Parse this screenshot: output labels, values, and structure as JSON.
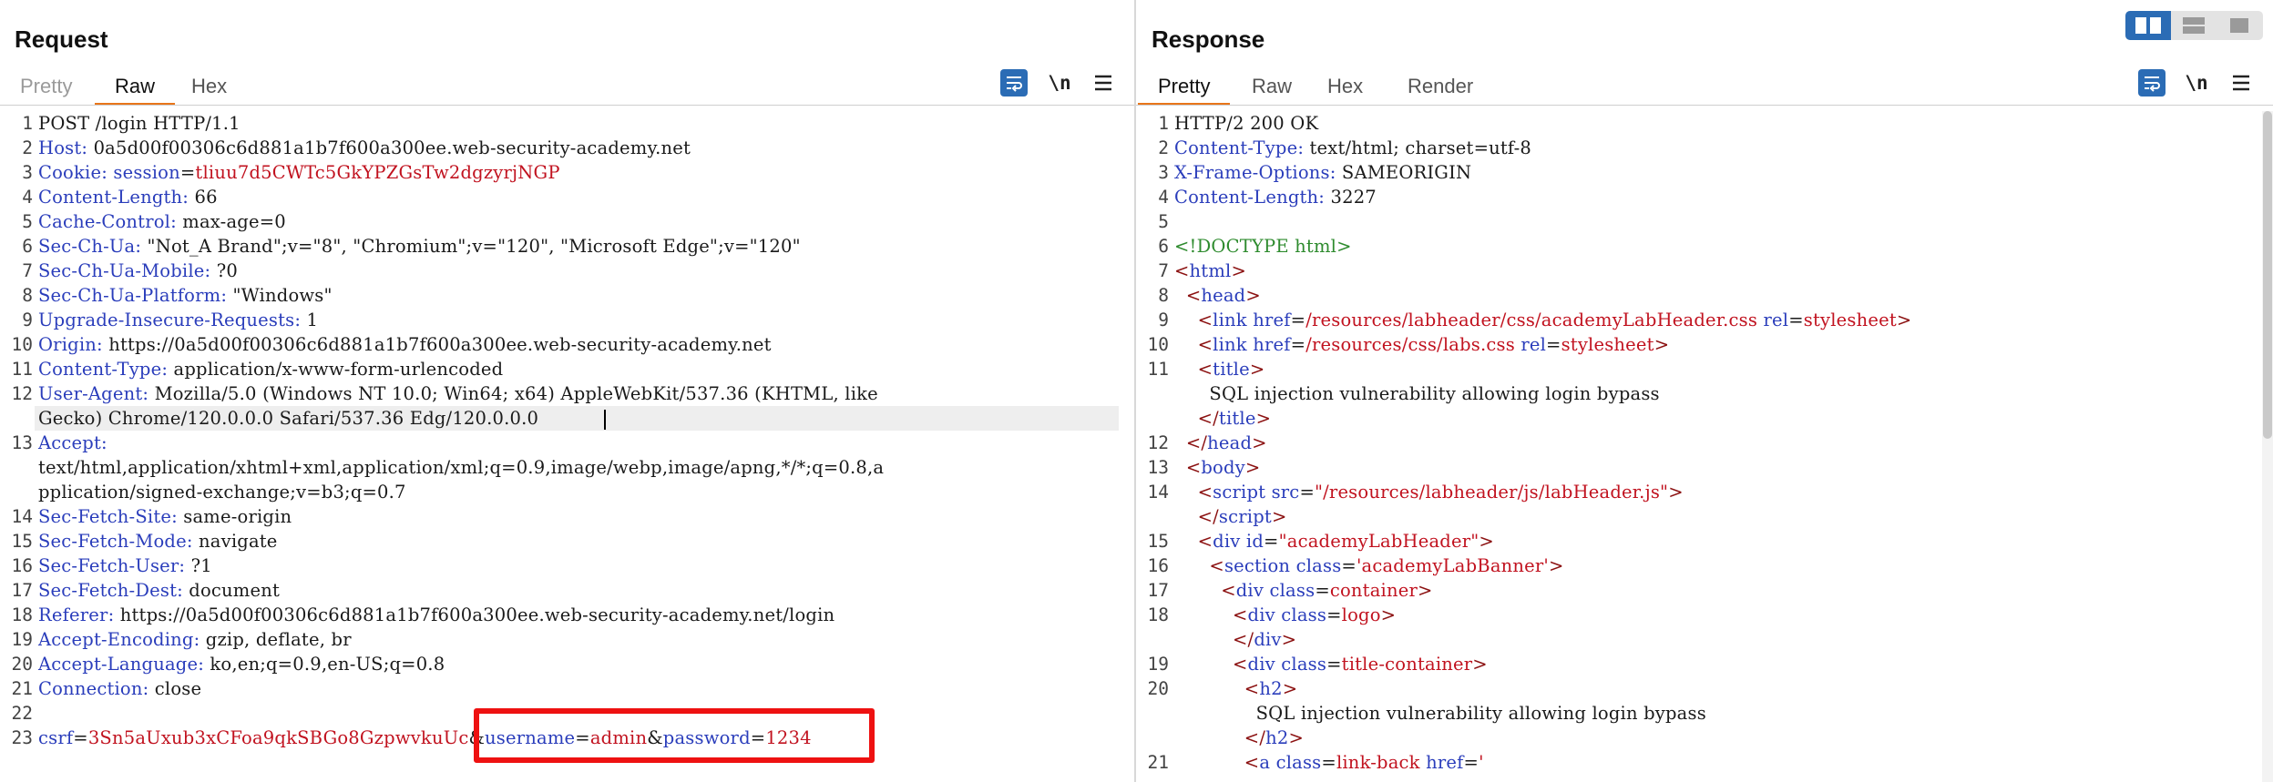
{
  "request": {
    "title": "Request",
    "tabs": [
      "Pretty",
      "Raw",
      "Hex"
    ],
    "active_tab": "Raw",
    "tools": {
      "wrap_icon": "wrap-lines-icon",
      "newline_label": "\\n",
      "menu_icon": "hamburger-menu-icon"
    },
    "lines": [
      {
        "n": "1",
        "parts": [
          [
            "t",
            "POST /login HTTP/1.1"
          ]
        ]
      },
      {
        "n": "2",
        "parts": [
          [
            "k",
            "Host:"
          ],
          [
            "t",
            " 0a5d00f00306c6d881a1b7f600a300ee.web-security-academy.net"
          ]
        ]
      },
      {
        "n": "3",
        "parts": [
          [
            "k",
            "Cookie:"
          ],
          [
            "t",
            " "
          ],
          [
            "k",
            "session"
          ],
          [
            "t",
            "="
          ],
          [
            "v",
            "tliuu7d5CWTc5GkYPZGsTw2dgzyrjNGP"
          ]
        ]
      },
      {
        "n": "4",
        "parts": [
          [
            "k",
            "Content-Length:"
          ],
          [
            "t",
            " 66"
          ]
        ]
      },
      {
        "n": "5",
        "parts": [
          [
            "k",
            "Cache-Control:"
          ],
          [
            "t",
            " max-age=0"
          ]
        ]
      },
      {
        "n": "6",
        "parts": [
          [
            "k",
            "Sec-Ch-Ua:"
          ],
          [
            "t",
            " \"Not_A Brand\";v=\"8\", \"Chromium\";v=\"120\", \"Microsoft Edge\";v=\"120\""
          ]
        ]
      },
      {
        "n": "7",
        "parts": [
          [
            "k",
            "Sec-Ch-Ua-Mobile:"
          ],
          [
            "t",
            " ?0"
          ]
        ]
      },
      {
        "n": "8",
        "parts": [
          [
            "k",
            "Sec-Ch-Ua-Platform:"
          ],
          [
            "t",
            " \"Windows\""
          ]
        ]
      },
      {
        "n": "9",
        "parts": [
          [
            "k",
            "Upgrade-Insecure-Requests:"
          ],
          [
            "t",
            " 1"
          ]
        ]
      },
      {
        "n": "10",
        "parts": [
          [
            "k",
            "Origin:"
          ],
          [
            "t",
            " https://0a5d00f00306c6d881a1b7f600a300ee.web-security-academy.net"
          ]
        ]
      },
      {
        "n": "11",
        "parts": [
          [
            "k",
            "Content-Type:"
          ],
          [
            "t",
            " application/x-www-form-urlencoded"
          ]
        ]
      },
      {
        "n": "12",
        "parts": [
          [
            "k",
            "User-Agent:"
          ],
          [
            "t",
            " Mozilla/5.0 (Windows NT 10.0; Win64; x64) AppleWebKit/537.36 (KHTML, like"
          ]
        ]
      },
      {
        "n": "",
        "parts": [
          [
            "t",
            "Gecko) Chrome/120.0.0.0 Safari/537.36 Edg/120.0.0.0"
          ]
        ]
      },
      {
        "n": "13",
        "parts": [
          [
            "k",
            "Accept:"
          ]
        ]
      },
      {
        "n": "",
        "parts": [
          [
            "t",
            "text/html,application/xhtml+xml,application/xml;q=0.9,image/webp,image/apng,*/*;q=0.8,a"
          ]
        ]
      },
      {
        "n": "",
        "parts": [
          [
            "t",
            "pplication/signed-exchange;v=b3;q=0.7"
          ]
        ]
      },
      {
        "n": "14",
        "parts": [
          [
            "k",
            "Sec-Fetch-Site:"
          ],
          [
            "t",
            " same-origin"
          ]
        ]
      },
      {
        "n": "15",
        "parts": [
          [
            "k",
            "Sec-Fetch-Mode:"
          ],
          [
            "t",
            " navigate"
          ]
        ]
      },
      {
        "n": "16",
        "parts": [
          [
            "k",
            "Sec-Fetch-User:"
          ],
          [
            "t",
            " ?1"
          ]
        ]
      },
      {
        "n": "17",
        "parts": [
          [
            "k",
            "Sec-Fetch-Dest:"
          ],
          [
            "t",
            " document"
          ]
        ]
      },
      {
        "n": "18",
        "parts": [
          [
            "k",
            "Referer:"
          ],
          [
            "t",
            " https://0a5d00f00306c6d881a1b7f600a300ee.web-security-academy.net/login"
          ]
        ]
      },
      {
        "n": "19",
        "parts": [
          [
            "k",
            "Accept-Encoding:"
          ],
          [
            "t",
            " gzip, deflate, br"
          ]
        ]
      },
      {
        "n": "20",
        "parts": [
          [
            "k",
            "Accept-Language:"
          ],
          [
            "t",
            " ko,en;q=0.9,en-US;q=0.8"
          ]
        ]
      },
      {
        "n": "21",
        "parts": [
          [
            "k",
            "Connection:"
          ],
          [
            "t",
            " close"
          ]
        ]
      },
      {
        "n": "22",
        "parts": []
      },
      {
        "n": "23",
        "parts": [
          [
            "k",
            "csrf"
          ],
          [
            "t",
            "="
          ],
          [
            "v",
            "3Sn5aUxub3xCFoa9qkSBGo8GzpwvkuUc"
          ],
          [
            "t",
            "&"
          ],
          [
            "k",
            "username"
          ],
          [
            "t",
            "="
          ],
          [
            "v",
            "admin"
          ],
          [
            "t",
            "&"
          ],
          [
            "k",
            "password"
          ],
          [
            "t",
            "="
          ],
          [
            "v",
            "1234"
          ]
        ]
      }
    ]
  },
  "response": {
    "title": "Response",
    "tabs": [
      "Pretty",
      "Raw",
      "Hex",
      "Render"
    ],
    "active_tab": "Pretty",
    "tools": {
      "wrap_icon": "wrap-lines-icon",
      "newline_label": "\\n",
      "menu_icon": "hamburger-menu-icon"
    },
    "lines": [
      {
        "n": "1",
        "parts": [
          [
            "t",
            "HTTP/2 200 OK"
          ]
        ]
      },
      {
        "n": "2",
        "parts": [
          [
            "k",
            "Content-Type:"
          ],
          [
            "t",
            " text/html; charset=utf-8"
          ]
        ]
      },
      {
        "n": "3",
        "parts": [
          [
            "k",
            "X-Frame-Options:"
          ],
          [
            "t",
            " SAMEORIGIN"
          ]
        ]
      },
      {
        "n": "4",
        "parts": [
          [
            "k",
            "Content-Length:"
          ],
          [
            "t",
            " 3227"
          ]
        ]
      },
      {
        "n": "5",
        "parts": []
      },
      {
        "n": "6",
        "parts": [
          [
            "dt",
            "<!DOCTYPE html>"
          ]
        ]
      },
      {
        "n": "7",
        "parts": [
          [
            "tg",
            "<"
          ],
          [
            "tn",
            "html"
          ],
          [
            "tg",
            ">"
          ]
        ]
      },
      {
        "n": "8",
        "parts": [
          [
            "t",
            "  "
          ],
          [
            "tg",
            "<"
          ],
          [
            "tn",
            "head"
          ],
          [
            "tg",
            ">"
          ]
        ]
      },
      {
        "n": "9",
        "parts": [
          [
            "t",
            "    "
          ],
          [
            "tg",
            "<"
          ],
          [
            "tn",
            "link"
          ],
          [
            "t",
            " "
          ],
          [
            "an",
            "href"
          ],
          [
            "t",
            "="
          ],
          [
            "av",
            "/resources/labheader/css/academyLabHeader.css"
          ],
          [
            "t",
            " "
          ],
          [
            "an",
            "rel"
          ],
          [
            "t",
            "="
          ],
          [
            "av",
            "stylesheet"
          ],
          [
            "tg",
            ">"
          ]
        ]
      },
      {
        "n": "10",
        "parts": [
          [
            "t",
            "    "
          ],
          [
            "tg",
            "<"
          ],
          [
            "tn",
            "link"
          ],
          [
            "t",
            " "
          ],
          [
            "an",
            "href"
          ],
          [
            "t",
            "="
          ],
          [
            "av",
            "/resources/css/labs.css"
          ],
          [
            "t",
            " "
          ],
          [
            "an",
            "rel"
          ],
          [
            "t",
            "="
          ],
          [
            "av",
            "stylesheet"
          ],
          [
            "tg",
            ">"
          ]
        ]
      },
      {
        "n": "11",
        "parts": [
          [
            "t",
            "    "
          ],
          [
            "tg",
            "<"
          ],
          [
            "tn",
            "title"
          ],
          [
            "tg",
            ">"
          ]
        ]
      },
      {
        "n": "",
        "parts": [
          [
            "t",
            "      SQL injection vulnerability allowing login bypass"
          ]
        ]
      },
      {
        "n": "",
        "parts": [
          [
            "t",
            "    "
          ],
          [
            "tg",
            "</"
          ],
          [
            "tn",
            "title"
          ],
          [
            "tg",
            ">"
          ]
        ]
      },
      {
        "n": "12",
        "parts": [
          [
            "t",
            "  "
          ],
          [
            "tg",
            "</"
          ],
          [
            "tn",
            "head"
          ],
          [
            "tg",
            ">"
          ]
        ]
      },
      {
        "n": "13",
        "parts": [
          [
            "t",
            "  "
          ],
          [
            "tg",
            "<"
          ],
          [
            "tn",
            "body"
          ],
          [
            "tg",
            ">"
          ]
        ]
      },
      {
        "n": "14",
        "parts": [
          [
            "t",
            "    "
          ],
          [
            "tg",
            "<"
          ],
          [
            "tn",
            "script"
          ],
          [
            "t",
            " "
          ],
          [
            "an",
            "src"
          ],
          [
            "t",
            "="
          ],
          [
            "av",
            "\"/resources/labheader/js/labHeader.js\""
          ],
          [
            "tg",
            ">"
          ]
        ]
      },
      {
        "n": "",
        "parts": [
          [
            "t",
            "    "
          ],
          [
            "tg",
            "</"
          ],
          [
            "tn",
            "script"
          ],
          [
            "tg",
            ">"
          ]
        ]
      },
      {
        "n": "15",
        "parts": [
          [
            "t",
            "    "
          ],
          [
            "tg",
            "<"
          ],
          [
            "tn",
            "div"
          ],
          [
            "t",
            " "
          ],
          [
            "an",
            "id"
          ],
          [
            "t",
            "="
          ],
          [
            "av",
            "\"academyLabHeader\""
          ],
          [
            "tg",
            ">"
          ]
        ]
      },
      {
        "n": "16",
        "parts": [
          [
            "t",
            "      "
          ],
          [
            "tg",
            "<"
          ],
          [
            "tn",
            "section"
          ],
          [
            "t",
            " "
          ],
          [
            "an",
            "class"
          ],
          [
            "t",
            "="
          ],
          [
            "av",
            "'academyLabBanner'"
          ],
          [
            "tg",
            ">"
          ]
        ]
      },
      {
        "n": "17",
        "parts": [
          [
            "t",
            "        "
          ],
          [
            "tg",
            "<"
          ],
          [
            "tn",
            "div"
          ],
          [
            "t",
            " "
          ],
          [
            "an",
            "class"
          ],
          [
            "t",
            "="
          ],
          [
            "av",
            "container"
          ],
          [
            "tg",
            ">"
          ]
        ]
      },
      {
        "n": "18",
        "parts": [
          [
            "t",
            "          "
          ],
          [
            "tg",
            "<"
          ],
          [
            "tn",
            "div"
          ],
          [
            "t",
            " "
          ],
          [
            "an",
            "class"
          ],
          [
            "t",
            "="
          ],
          [
            "av",
            "logo"
          ],
          [
            "tg",
            ">"
          ]
        ]
      },
      {
        "n": "",
        "parts": [
          [
            "t",
            "          "
          ],
          [
            "tg",
            "</"
          ],
          [
            "tn",
            "div"
          ],
          [
            "tg",
            ">"
          ]
        ]
      },
      {
        "n": "19",
        "parts": [
          [
            "t",
            "          "
          ],
          [
            "tg",
            "<"
          ],
          [
            "tn",
            "div"
          ],
          [
            "t",
            " "
          ],
          [
            "an",
            "class"
          ],
          [
            "t",
            "="
          ],
          [
            "av",
            "title-container"
          ],
          [
            "tg",
            ">"
          ]
        ]
      },
      {
        "n": "20",
        "parts": [
          [
            "t",
            "            "
          ],
          [
            "tg",
            "<"
          ],
          [
            "tn",
            "h2"
          ],
          [
            "tg",
            ">"
          ]
        ]
      },
      {
        "n": "",
        "parts": [
          [
            "t",
            "              SQL injection vulnerability allowing login bypass"
          ]
        ]
      },
      {
        "n": "",
        "parts": [
          [
            "t",
            "            "
          ],
          [
            "tg",
            "</"
          ],
          [
            "tn",
            "h2"
          ],
          [
            "tg",
            ">"
          ]
        ]
      },
      {
        "n": "21",
        "parts": [
          [
            "t",
            "            "
          ],
          [
            "tg",
            "<"
          ],
          [
            "tn",
            "a"
          ],
          [
            "t",
            " "
          ],
          [
            "an",
            "class"
          ],
          [
            "t",
            "="
          ],
          [
            "av",
            "link-back"
          ],
          [
            "t",
            " "
          ],
          [
            "an",
            "href"
          ],
          [
            "t",
            "="
          ],
          [
            "av",
            "'"
          ]
        ]
      }
    ]
  },
  "layout_toggle": {
    "icons": [
      "split-horizontal-icon",
      "split-vertical-icon",
      "single-pane-icon"
    ],
    "active": 0
  },
  "colors": {
    "accent": "#e8761a",
    "tool_blue": "#2b6cb5",
    "highlight_box": "#ee1111",
    "header_name": "#2a3dbb",
    "param_value": "#c1121f",
    "doctype": "#2e8b2e"
  }
}
